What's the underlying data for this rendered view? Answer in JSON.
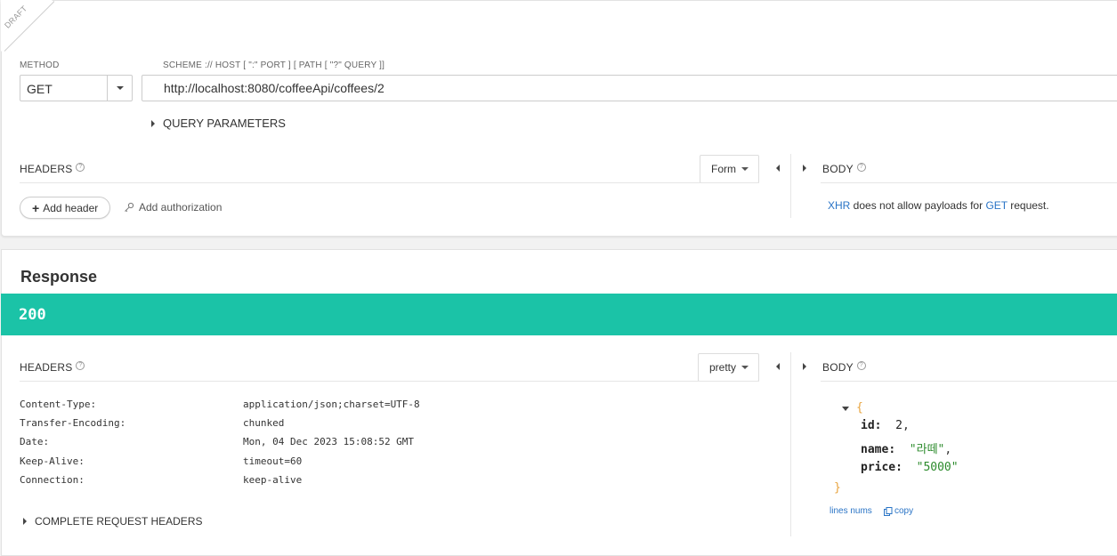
{
  "request": {
    "draft_label": "DRAFT",
    "method_label": "METHOD",
    "method_value": "GET",
    "url_label": "SCHEME :// HOST [ \":\" PORT ] [ PATH [ \"?\" QUERY ]]",
    "url_value": "http://localhost:8080/coffeeApi/coffees/2",
    "query_params_label": "QUERY PARAMETERS",
    "headers_label": "HEADERS",
    "headers_mode": "Form",
    "body_label": "BODY",
    "add_header_label": "Add header",
    "add_auth_label": "Add authorization",
    "payload_msg": {
      "xhr": "XHR",
      "middle": " does not allow payloads for ",
      "get": "GET",
      "end": " request."
    }
  },
  "response": {
    "title": "Response",
    "status_code": "200",
    "status_color": "#1bc3a7",
    "headers_label": "HEADERS",
    "headers_mode": "pretty",
    "body_label": "BODY",
    "headers": [
      {
        "name": "Content-Type:",
        "value": "application/json;charset=UTF-8"
      },
      {
        "name": "Transfer-Encoding:",
        "value": "chunked"
      },
      {
        "name": "Date:",
        "value": "Mon, 04 Dec 2023 15:08:52 GMT"
      },
      {
        "name": "Keep-Alive:",
        "value": "timeout=60"
      },
      {
        "name": "Connection:",
        "value": "keep-alive"
      }
    ],
    "complete_headers_label": "COMPLETE REQUEST HEADERS",
    "body": {
      "open_brace": "{",
      "close_brace": "}",
      "fields": [
        {
          "key": "id",
          "value": "2",
          "type": "number",
          "comma": ","
        },
        {
          "key": "name",
          "value": "\"라떼\"",
          "type": "string",
          "comma": ","
        },
        {
          "key": "price",
          "value": "\"5000\"",
          "type": "string",
          "comma": ""
        }
      ]
    },
    "lines_nums_label": "lines nums",
    "copy_label": "copy"
  },
  "colors": {
    "accent": "#1bc3a7",
    "link": "#2a74c6",
    "json_brace": "#e8a33d",
    "json_string": "#2b8a2b"
  }
}
